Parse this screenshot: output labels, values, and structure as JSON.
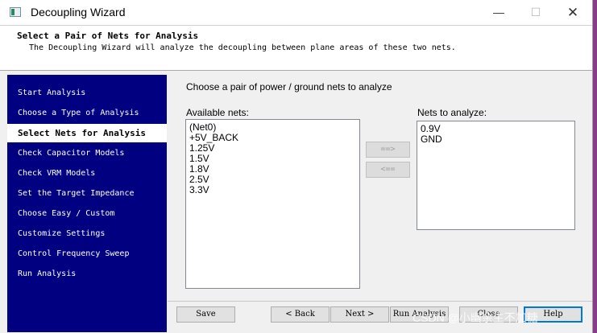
{
  "window": {
    "title": "Decoupling Wizard",
    "minimize": "—",
    "maximize": "☐",
    "close": "✕"
  },
  "header": {
    "title": "Select a Pair of Nets for Analysis",
    "description": "The Decoupling Wizard will analyze the decoupling between plane areas of these two nets."
  },
  "sidebar": {
    "steps": [
      "Start Analysis",
      "Choose a Type of Analysis",
      "Select Nets for Analysis",
      "Check Capacitor Models",
      "Check VRM Models",
      "Set the Target Impedance",
      "Choose Easy / Custom",
      "Customize Settings",
      "Control Frequency Sweep",
      "Run Analysis"
    ],
    "active_index": 2
  },
  "main": {
    "prompt": "Choose a pair of power / ground nets to analyze",
    "available_label": "Available nets:",
    "available_nets": [
      "(Net0)",
      "+5V_BACK",
      "1.25V",
      "1.5V",
      "1.8V",
      "2.5V",
      "3.3V"
    ],
    "analyze_label": "Nets to analyze:",
    "analyze_nets": [
      "0.9V",
      "GND"
    ],
    "add_button": "==>",
    "remove_button": "<=="
  },
  "footer": {
    "save": "Save",
    "back": "< Back",
    "next": "Next >",
    "run": "Run Analysis",
    "close": "Close",
    "help": "Help"
  },
  "watermark": "CSDN @小幽余生不加糖",
  "colors": {
    "sidebar_bg": "#000080",
    "active_step_bg": "#ffffff",
    "window_bg": "#f0f0f0",
    "default_button_border": "#0078d7"
  }
}
